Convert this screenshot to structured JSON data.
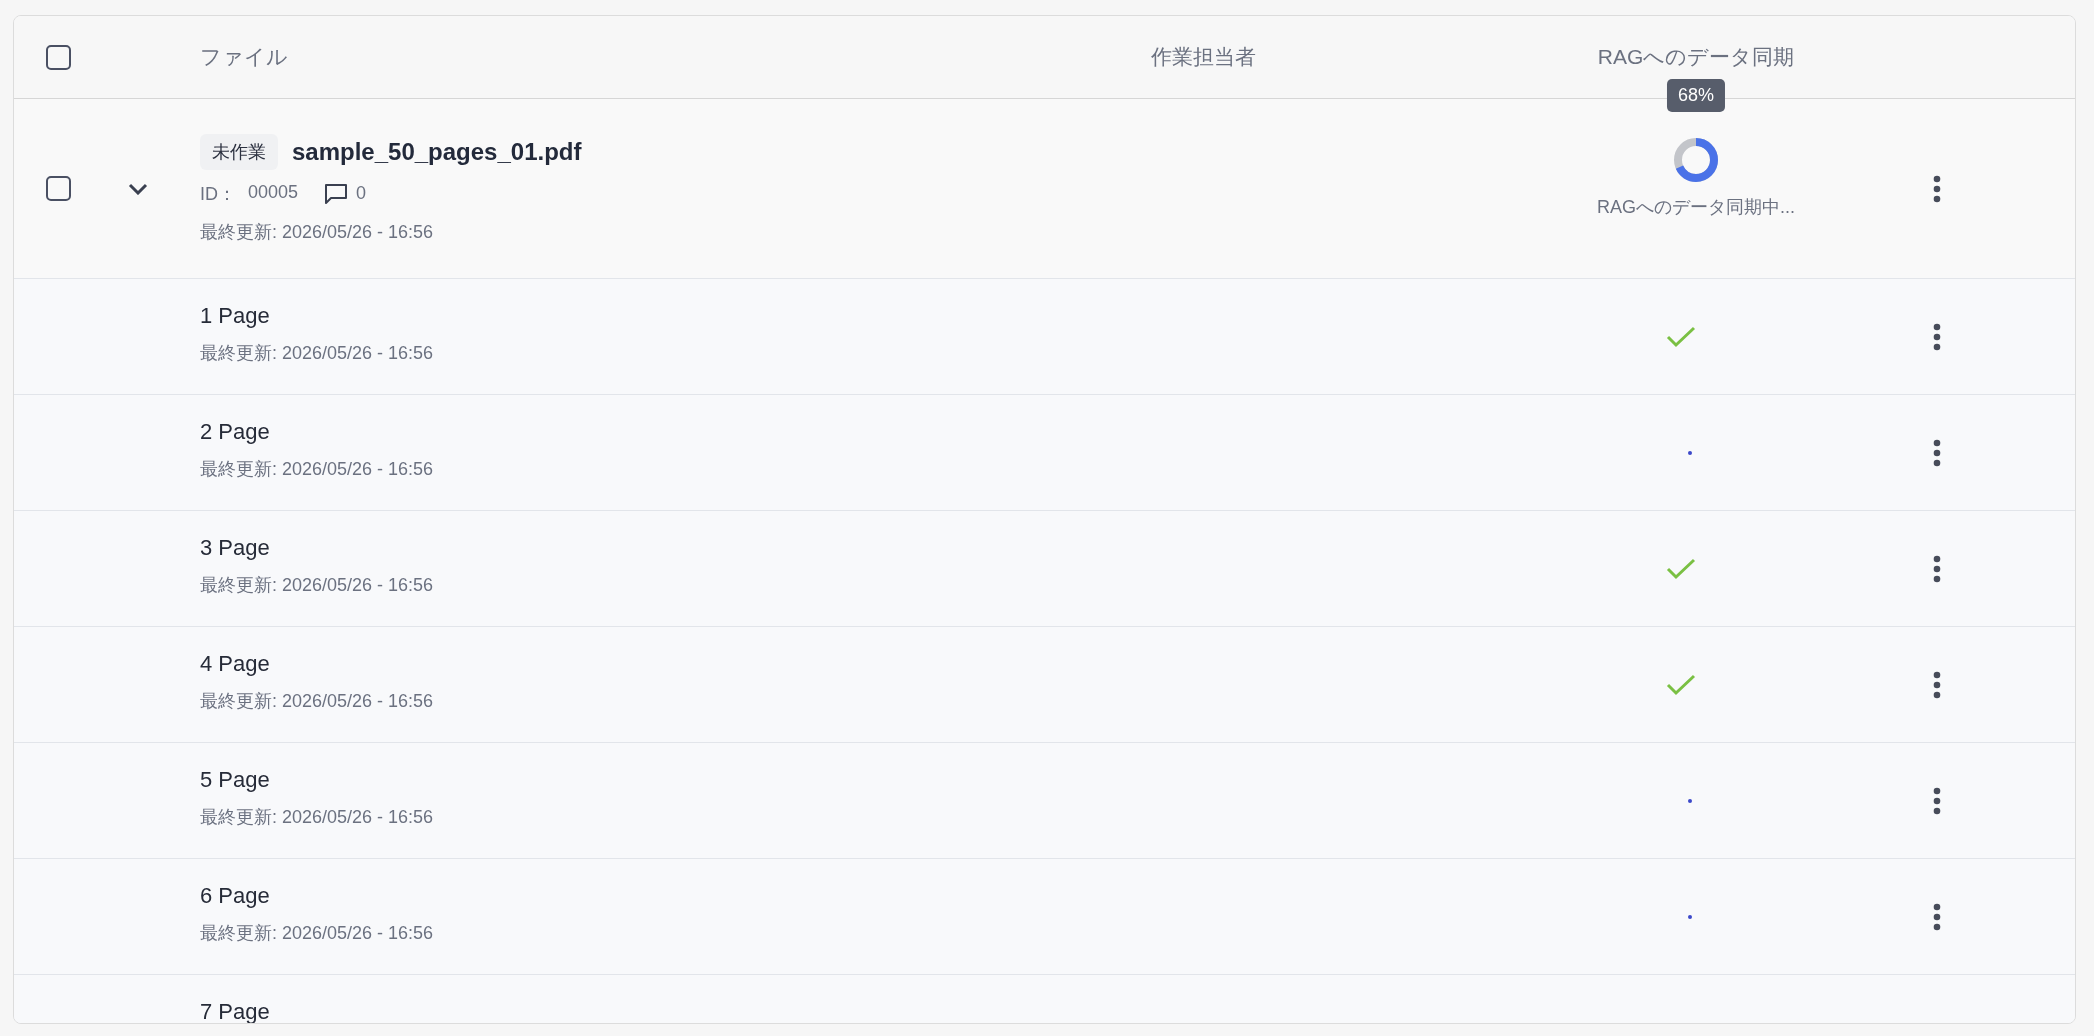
{
  "header": {
    "select_all": {
      "checked": false
    },
    "columns": [
      "ファイル",
      "作業担当者",
      "RAGへのデータ同期"
    ]
  },
  "file": {
    "checked": false,
    "expanded": true,
    "status": "未作業",
    "name": "sample_50_pages_01.pdf",
    "id_label": "ID：",
    "id": "00005",
    "comments": "0",
    "updated": "最終更新: 2026/05/26 - 16:56",
    "sync": {
      "kind": "progress",
      "level": 0.68,
      "tooltip": "68%",
      "label": "RAGへのデータ同期中..."
    }
  },
  "pages": [
    {
      "name": "1 Page",
      "updated": "最終更新: 2026/05/26 - 16:56",
      "sync": {
        "kind": "done"
      }
    },
    {
      "name": "2 Page",
      "updated": "最終更新: 2026/05/26 - 16:56",
      "sync": {
        "kind": "pending"
      }
    },
    {
      "name": "3 Page",
      "updated": "最終更新: 2026/05/26 - 16:56",
      "sync": {
        "kind": "done"
      }
    },
    {
      "name": "4 Page",
      "updated": "最終更新: 2026/05/26 - 16:56",
      "sync": {
        "kind": "done"
      }
    },
    {
      "name": "5 Page",
      "updated": "最終更新: 2026/05/26 - 16:56",
      "sync": {
        "kind": "pending"
      }
    },
    {
      "name": "6 Page",
      "updated": "最終更新: 2026/05/26 - 16:56",
      "sync": {
        "kind": "pending"
      }
    },
    {
      "name": "7 Page"
    }
  ]
}
